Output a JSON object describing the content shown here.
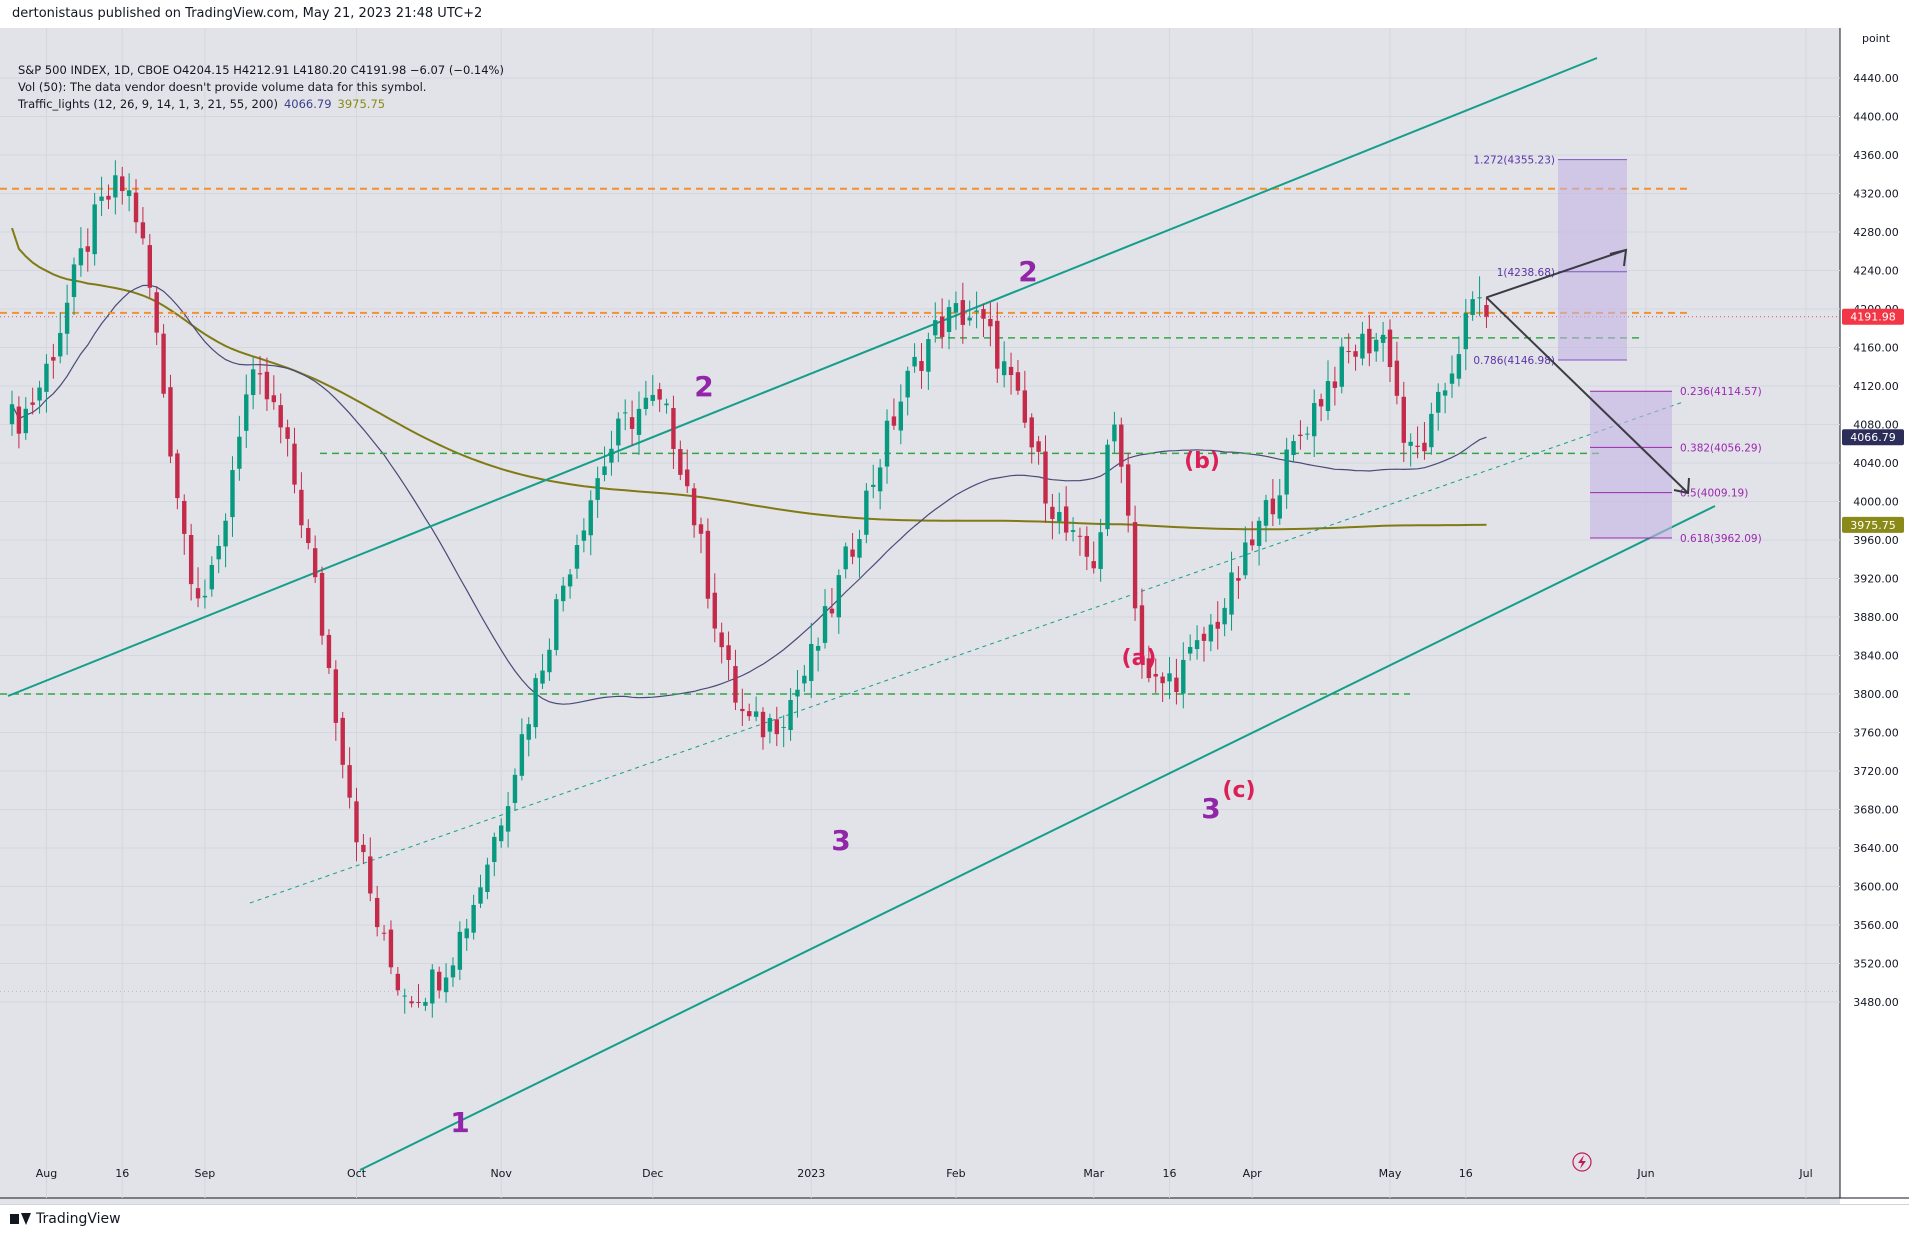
{
  "header": {
    "published_line": "dertonistaus published on TradingView.com, May 21, 2023 21:48 UTC+2"
  },
  "legend": {
    "symbol_line": "S&P 500 INDEX, 1D, CBOE  O4204.15  H4212.91  L4180.20  C4191.98  −6.07 (−0.14%)",
    "volume_line": "Vol (50): The data vendor doesn't provide volume data for this symbol.",
    "indicator_name": "Traffic_lights (12, 26, 9, 14, 1, 3, 21, 55, 200)",
    "indicator_value_1": "4066.79",
    "indicator_value_2": "3975.75"
  },
  "price_axis": {
    "unit_label": "point",
    "ticks": [
      "4440.00",
      "4400.00",
      "4360.00",
      "4320.00",
      "4280.00",
      "4240.00",
      "4200.00",
      "4160.00",
      "4120.00",
      "4080.00",
      "4040.00",
      "4000.00",
      "3960.00",
      "3920.00",
      "3880.00",
      "3840.00",
      "3800.00",
      "3760.00",
      "3720.00",
      "3680.00",
      "3640.00",
      "3600.00",
      "3560.00",
      "3520.00",
      "3480.00"
    ],
    "last_price_tag": "4191.98",
    "ma_fast_tag": "4066.79",
    "ma_slow_tag": "3975.75"
  },
  "time_axis": {
    "labels": [
      "Aug",
      "16",
      "Sep",
      "Oct",
      "Nov",
      "Dec",
      "2023",
      "Feb",
      "Mar",
      "16",
      "Apr",
      "May",
      "16",
      "Jun",
      "Jul"
    ]
  },
  "annotations": {
    "wave_labels_purple": [
      "1",
      "2",
      "3",
      "2",
      "3"
    ],
    "wave_labels_red": [
      "(a)",
      "(b)",
      "(c)"
    ],
    "fib_extension": [
      "1.272(4355.23)",
      "1(4238.68)",
      "0.786(4146.98)"
    ],
    "fib_retracement": [
      "0.236(4114.57)",
      "0.382(4056.29)",
      "0.5(4009.19)",
      "0.618(3962.09)"
    ]
  },
  "colors": {
    "background": "#e1e3e8",
    "bull": "#089981",
    "bear": "#c42a4a",
    "channel": "#159e8a",
    "ma_fast": "#4a4a78",
    "ma_slow": "#817a14",
    "wave_purple": "#9226a8",
    "wave_red": "#dc1f56",
    "resistance_orange": "#f2912e",
    "support_green": "#35a645",
    "fib_box": "#c4b2e2"
  },
  "footer": {
    "brand": "TradingView"
  },
  "chart_data": {
    "type": "candlestick",
    "symbol": "S&P 500 INDEX",
    "interval": "1D",
    "ylim": [
      3480,
      4440
    ],
    "last": {
      "open": 4204.15,
      "high": 4212.91,
      "low": 4180.2,
      "close": 4191.98,
      "change": -6.07,
      "change_pct": -0.14
    },
    "swing_points": [
      {
        "date": "2022-08-16",
        "price": 4325
      },
      {
        "date": "2022-09-01",
        "price": 3905
      },
      {
        "date": "2022-09-12",
        "price": 4119
      },
      {
        "date": "2022-10-13",
        "price": 3491
      },
      {
        "date": "2022-12-01",
        "price": 4100
      },
      {
        "date": "2022-12-22",
        "price": 3765
      },
      {
        "date": "2023-02-02",
        "price": 4195
      },
      {
        "date": "2023-03-01",
        "price": 3940
      },
      {
        "date": "2023-03-06",
        "price": 4078
      },
      {
        "date": "2023-03-13",
        "price": 3808
      },
      {
        "date": "2023-04-28",
        "price": 4170
      },
      {
        "date": "2023-05-04",
        "price": 4048
      },
      {
        "date": "2023-05-19",
        "price": 4212
      }
    ],
    "moving_averages": [
      {
        "name": "fast",
        "last": 4066.79
      },
      {
        "name": "slow",
        "last": 3975.75
      }
    ],
    "horizontal_levels": [
      {
        "style": "orange-dashed",
        "price": 4325
      },
      {
        "style": "orange-dashed",
        "price": 4196
      },
      {
        "style": "green-dashed",
        "price": 4170
      },
      {
        "style": "green-dashed",
        "price": 4050
      },
      {
        "style": "green-dashed",
        "price": 3800
      }
    ],
    "fib_extension_levels": [
      4355.23,
      4238.68,
      4146.98
    ],
    "fib_retracement_levels": [
      4114.57,
      4056.29,
      4009.19,
      3962.09
    ]
  }
}
